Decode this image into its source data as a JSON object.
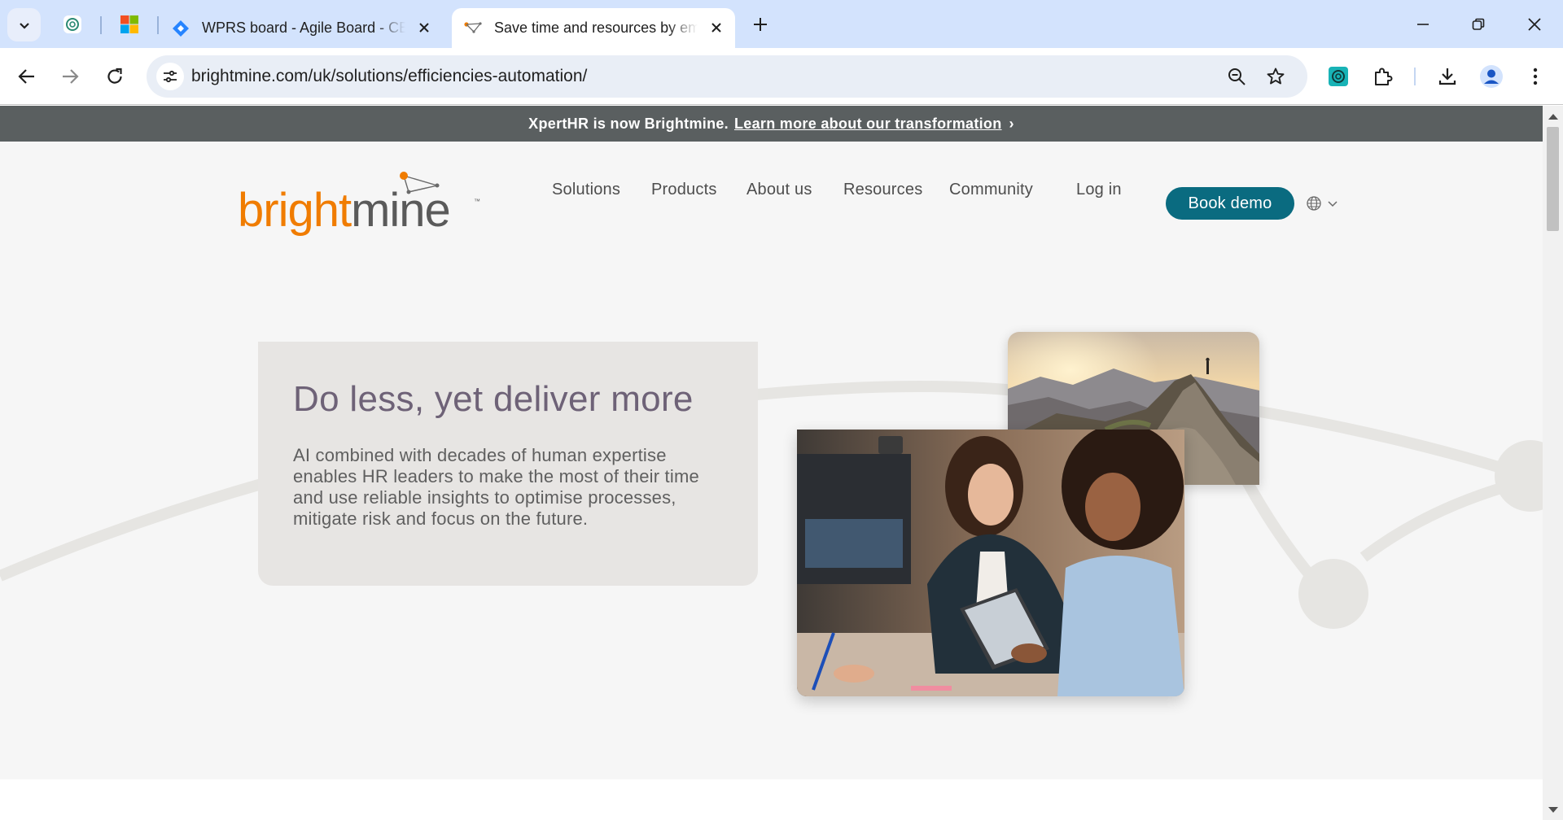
{
  "browser": {
    "tabs": [
      {
        "title": "WPRS board - Agile Board - CE",
        "favicon": "jira-diamond-icon"
      },
      {
        "title": "Save time and resources by em",
        "favicon": "brightmine-favicon",
        "active": true
      }
    ],
    "pinned_tab_icons": [
      "chatgpt-icon",
      "microsoft-icon"
    ],
    "url": "brightmine.com/uk/solutions/efficiencies-automation/",
    "colors": {
      "tabbar": "#d3e3fd",
      "omnibox": "#e9eef6"
    }
  },
  "page": {
    "announcement": {
      "text": "XpertHR is now Brightmine.",
      "link": "Learn more about our transformation",
      "chevron": "›"
    },
    "logo_text": {
      "bright": "bright",
      "mine": "mine",
      "tm": "™"
    },
    "nav": {
      "items": [
        "Solutions",
        "Products",
        "About us",
        "Resources",
        "Community"
      ],
      "login": "Log in",
      "cta": "Book demo"
    },
    "hero": {
      "heading": "Do less, yet deliver more",
      "body": "AI combined with decades of human expertise enables HR leaders to make the most of their time and use reliable insights to optimise processes, mitigate risk and focus on the future."
    },
    "colors": {
      "brand_orange": "#f07c00",
      "brand_gray": "#5a5a5a",
      "cta_teal": "#0a6b80",
      "heading_purple": "#6e6277",
      "announce_bg": "#5a5f60"
    }
  }
}
